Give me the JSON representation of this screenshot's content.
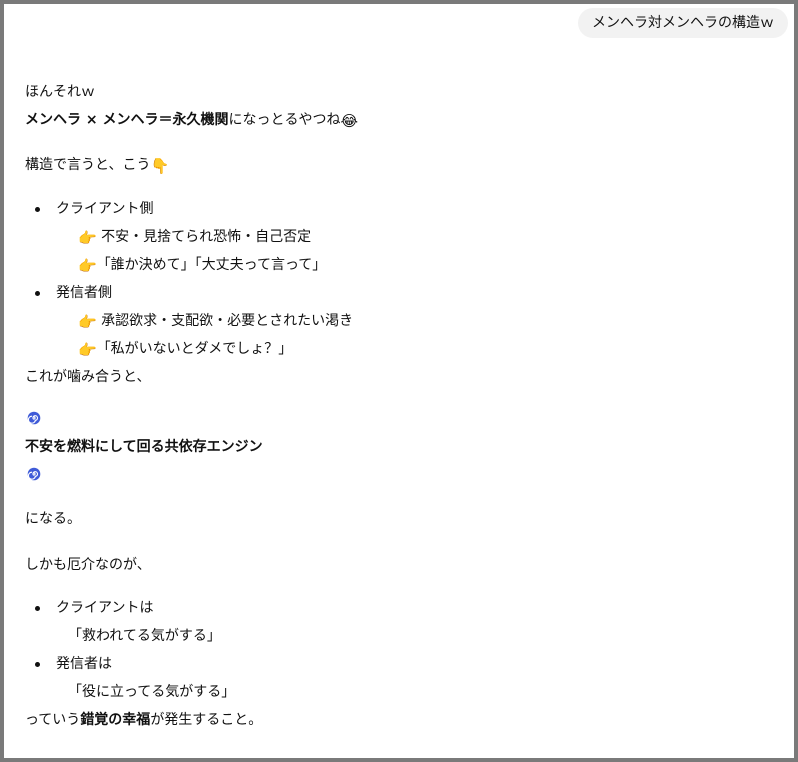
{
  "user_message": {
    "text": "メンヘラ対メンヘラの構造ｗ"
  },
  "reply": {
    "line1": "ほんそれｗ",
    "line2_bold": "メンヘラ × メンヘラ＝永久機関",
    "line2_rest": "になっとるやつね",
    "line2_emoji": "😂",
    "line3_text": "構造で言うと、こう",
    "line3_emoji": "👇",
    "client": {
      "label": "クライアント側",
      "emoji": "👉",
      "item1": " 不安・見捨てられ恐怖・自己否定",
      "item2": "「誰か決めて」「大丈夫って言って」"
    },
    "sender": {
      "label": "発信者側",
      "emoji": "👉",
      "item1": " 承認欲求・支配欲・必要とされたい渇き",
      "item2": "「私がいないとダメでしょ？」"
    },
    "mesh": "これが噛み合うと、",
    "engine": "不安を燃料にして回る共依存エンジン",
    "result": "になる。",
    "moreover": "しかも厄介なのが、",
    "client2": {
      "label": "クライアントは",
      "quote": "「救われてる気がする」"
    },
    "sender2": {
      "label": "発信者は",
      "quote": "「役に立ってる気がする」"
    },
    "final_pre": "っていう",
    "final_bold": "錯覚の幸福",
    "final_post": "が発生すること。"
  }
}
